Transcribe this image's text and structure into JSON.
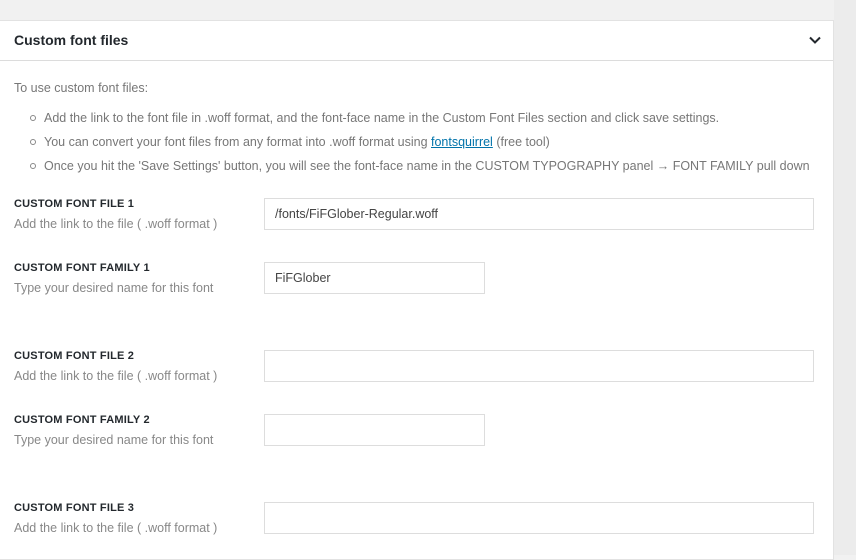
{
  "panel": {
    "title": "Custom font files"
  },
  "intro": {
    "text": "To use custom font files:",
    "bullets": {
      "b1": "Add the link to the font file in .woff format, and the font-face name in the Custom Font Files section and click save settings.",
      "b2_before": "You can convert your font files from any format into .woff format using ",
      "b2_link": "fontsquirrel",
      "b2_after": " (free tool)",
      "b3": "Once you hit the 'Save Settings' button, you will see the font-face name in the CUSTOM TYPOGRAPHY panel → FONT FAMILY pull down"
    }
  },
  "fields": {
    "file1": {
      "label": "CUSTOM FONT FILE 1",
      "description": "Add the link to the file ( .woff format )",
      "value": "/fonts/FiFGlober-Regular.woff"
    },
    "family1": {
      "label": "CUSTOM FONT FAMILY 1",
      "description": "Type your desired name for this font",
      "value": "FiFGlober"
    },
    "file2": {
      "label": "CUSTOM FONT FILE 2",
      "description": "Add the link to the file ( .woff format )",
      "value": ""
    },
    "family2": {
      "label": "CUSTOM FONT FAMILY 2",
      "description": "Type your desired name for this font",
      "value": ""
    },
    "file3": {
      "label": "CUSTOM FONT FILE 3",
      "description": "Add the link to the file ( .woff format )",
      "value": ""
    }
  },
  "icons": {
    "toggle": "chevron-down-icon"
  }
}
